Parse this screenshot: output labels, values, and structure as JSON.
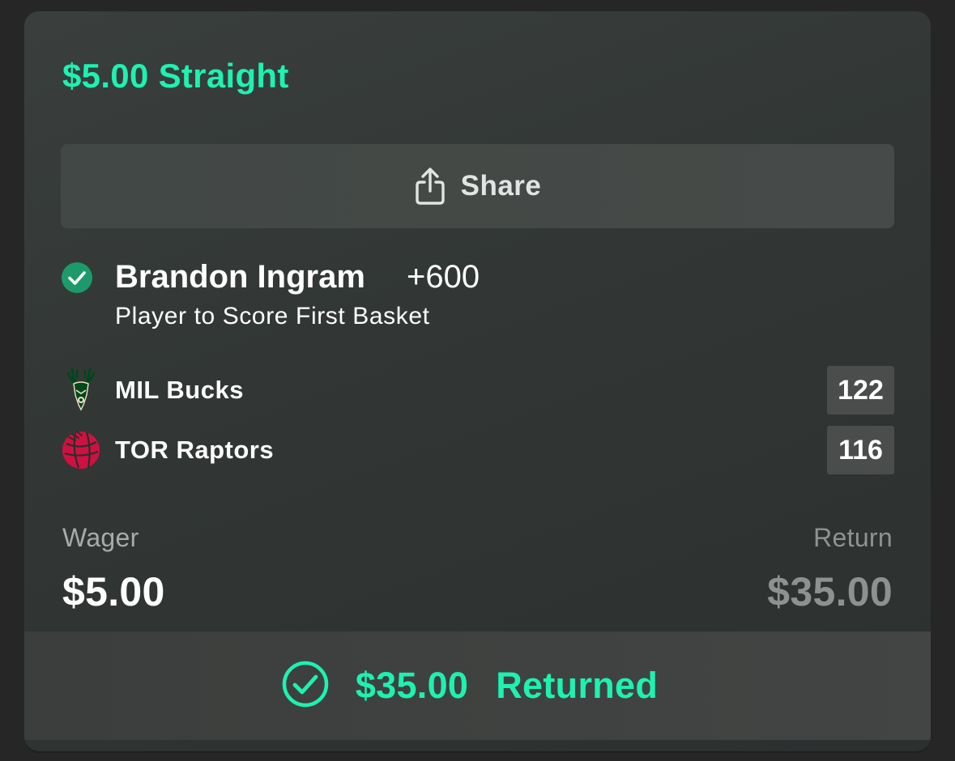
{
  "bet": {
    "title": "$5.00 Straight",
    "share_label": "Share"
  },
  "selection": {
    "player": "Brandon Ingram",
    "odds": "+600",
    "market": "Player to Score First Basket",
    "status_icon": "check-circle-icon"
  },
  "teams": [
    {
      "name": "MIL Bucks",
      "score": "122",
      "logo": "bucks-logo"
    },
    {
      "name": "TOR Raptors",
      "score": "116",
      "logo": "raptors-logo"
    }
  ],
  "summary": {
    "wager_label": "Wager",
    "wager_value": "$5.00",
    "return_label": "Return",
    "return_value": "$35.00"
  },
  "footer": {
    "amount": "$35.00",
    "status_text": "Returned",
    "icon": "check-circle-icon"
  },
  "colors": {
    "accent": "#1df2b0",
    "win_badge": "#1d9a6c",
    "bucks_green": "#00471b",
    "raptors_red": "#ce1141"
  }
}
